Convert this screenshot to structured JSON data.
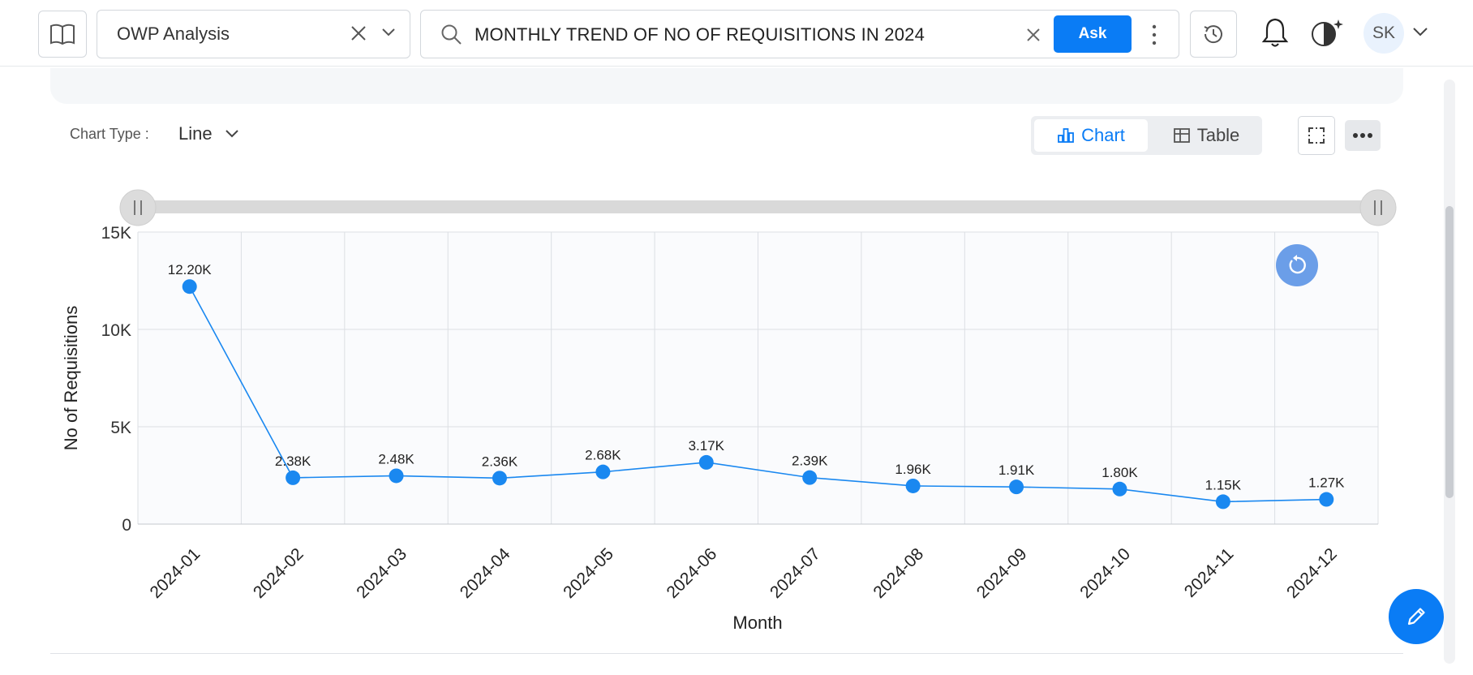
{
  "topbar": {
    "dataset": "OWP Analysis",
    "query": "MONTHLY TREND OF NO OF REQUISITIONS IN 2024",
    "ask_label": "Ask",
    "avatar_initials": "SK"
  },
  "controls": {
    "chart_type_label": "Chart Type :",
    "chart_type_value": "Line",
    "view_chart_label": "Chart",
    "view_table_label": "Table"
  },
  "colors": {
    "accent": "#0a7cf5",
    "line": "#1a88f0",
    "grid": "#dcdfe4",
    "plot_bg": "#fafbfd"
  },
  "chart_data": {
    "type": "line",
    "title": "",
    "xlabel": "Month",
    "ylabel": "No of Requisitions",
    "ylim": [
      0,
      15000
    ],
    "yticks": [
      0,
      5000,
      10000,
      15000
    ],
    "ytick_labels": [
      "0",
      "5K",
      "10K",
      "15K"
    ],
    "grid": true,
    "categories": [
      "2024-01",
      "2024-02",
      "2024-03",
      "2024-04",
      "2024-05",
      "2024-06",
      "2024-07",
      "2024-08",
      "2024-09",
      "2024-10",
      "2024-11",
      "2024-12"
    ],
    "values": [
      12200,
      2380,
      2480,
      2360,
      2680,
      3170,
      2390,
      1960,
      1910,
      1800,
      1150,
      1270
    ],
    "data_labels": [
      "12.20K",
      "2.38K",
      "2.48K",
      "2.36K",
      "2.68K",
      "3.17K",
      "2.39K",
      "1.96K",
      "1.91K",
      "1.80K",
      "1.15K",
      "1.27K"
    ]
  }
}
